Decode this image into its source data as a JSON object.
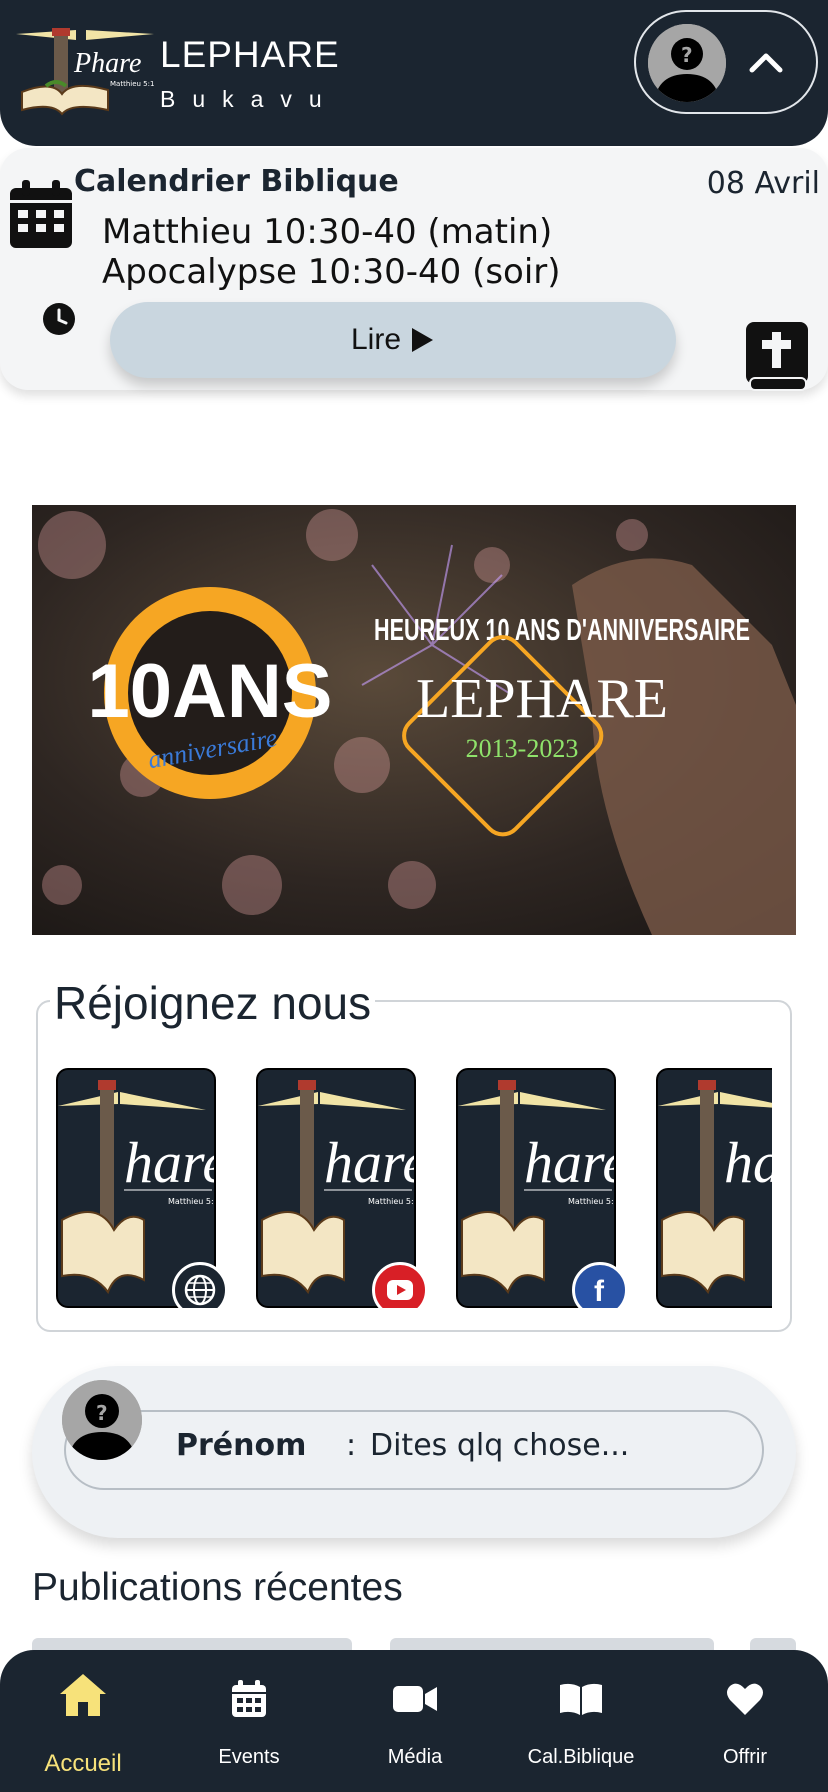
{
  "header": {
    "title": "LEPHARE",
    "subtitle": "Bukavu",
    "logo_text": "Phare",
    "logo_verse": "Matthieu 5:14"
  },
  "calendar": {
    "title": "Calendrier Biblique",
    "date": "08 Avril",
    "verse_morning": "Matthieu 10:30-40 (matin)",
    "verse_evening": "Apocalypse 10:30-40 (soir)",
    "read_label": "Lire"
  },
  "banner": {
    "badge_big": "10ANS",
    "badge_small": "anniversaire",
    "headline": "HEUREUX 10 ANS D'ANNIVERSAIRE",
    "brand": "LEPHARE",
    "years": "2013-2023"
  },
  "join": {
    "title": "Réjoignez nous",
    "tiles": [
      {
        "badge": "globe-icon",
        "badge_color": "#1b2530"
      },
      {
        "badge": "youtube-icon",
        "badge_color": "#d81f26"
      },
      {
        "badge": "facebook-icon",
        "badge_color": "#2851a3"
      },
      {
        "badge": "none",
        "badge_color": ""
      }
    ]
  },
  "composer": {
    "name_label": "Prénom",
    "separator": ":",
    "placeholder": "Dites qlq chose..."
  },
  "recent": {
    "title": "Publications récentes"
  },
  "nav": {
    "items": [
      {
        "label": "Accueil",
        "icon": "home-icon",
        "active": true
      },
      {
        "label": "Events",
        "icon": "calendar-icon",
        "active": false
      },
      {
        "label": "Média",
        "icon": "video-icon",
        "active": false
      },
      {
        "label": "Cal.Biblique",
        "icon": "book-open-icon",
        "active": false
      },
      {
        "label": "Offrir",
        "icon": "heart-icon",
        "active": false
      }
    ]
  },
  "colors": {
    "dark": "#1b2530",
    "accent_active": "#f7e27a",
    "button_bg": "#c9d6df",
    "banner_orange": "#f6a623",
    "banner_green": "#8fe36b"
  }
}
